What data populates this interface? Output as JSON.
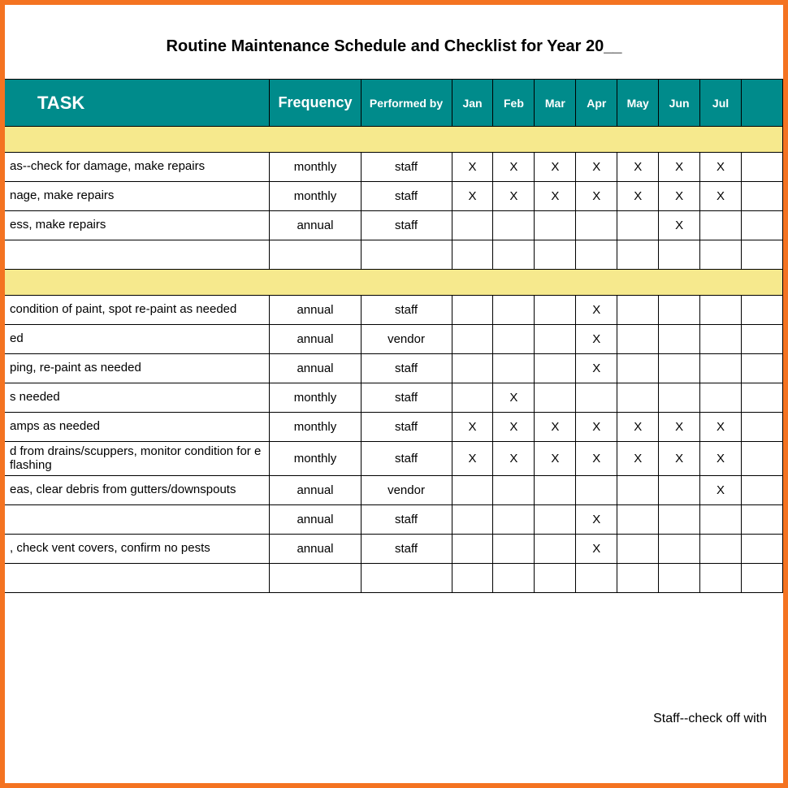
{
  "title": "Routine Maintenance Schedule and Checklist for Year 20__",
  "headers": {
    "task": "TASK",
    "frequency": "Frequency",
    "performed_by": "Performed by",
    "months": [
      "Jan",
      "Feb",
      "Mar",
      "Apr",
      "May",
      "Jun",
      "Jul",
      ""
    ]
  },
  "mark": "X",
  "section1_rows": [
    {
      "task": "as--check for damage, make repairs",
      "freq": "monthly",
      "perf": "staff",
      "marks": [
        true,
        true,
        true,
        true,
        true,
        true,
        true,
        false
      ]
    },
    {
      "task": "nage, make repairs",
      "freq": "monthly",
      "perf": "staff",
      "marks": [
        true,
        true,
        true,
        true,
        true,
        true,
        true,
        false
      ]
    },
    {
      "task": "ess, make repairs",
      "freq": "annual",
      "perf": "staff",
      "marks": [
        false,
        false,
        false,
        false,
        false,
        true,
        false,
        false
      ]
    },
    {
      "task": "",
      "freq": "",
      "perf": "",
      "marks": [
        false,
        false,
        false,
        false,
        false,
        false,
        false,
        false
      ]
    }
  ],
  "section2_rows": [
    {
      "task": "condition of paint, spot re-paint as needed",
      "freq": "annual",
      "perf": "staff",
      "marks": [
        false,
        false,
        false,
        true,
        false,
        false,
        false,
        false
      ]
    },
    {
      "task": "ed",
      "freq": "annual",
      "perf": "vendor",
      "marks": [
        false,
        false,
        false,
        true,
        false,
        false,
        false,
        false
      ]
    },
    {
      "task": "ping, re-paint as needed",
      "freq": "annual",
      "perf": "staff",
      "marks": [
        false,
        false,
        false,
        true,
        false,
        false,
        false,
        false
      ]
    },
    {
      "task": "s needed",
      "freq": "monthly",
      "perf": "staff",
      "marks": [
        false,
        true,
        false,
        false,
        false,
        false,
        false,
        false
      ]
    },
    {
      "task": "amps as needed",
      "freq": "monthly",
      "perf": "staff",
      "marks": [
        true,
        true,
        true,
        true,
        true,
        true,
        true,
        false
      ]
    },
    {
      "task": "d from drains/scuppers, monitor condition for e flashing",
      "freq": "monthly",
      "perf": "staff",
      "marks": [
        true,
        true,
        true,
        true,
        true,
        true,
        true,
        false
      ]
    },
    {
      "task": "eas, clear debris from gutters/downspouts",
      "freq": "annual",
      "perf": "vendor",
      "marks": [
        false,
        false,
        false,
        false,
        false,
        false,
        true,
        false
      ]
    },
    {
      "task": "",
      "freq": "annual",
      "perf": "staff",
      "marks": [
        false,
        false,
        false,
        true,
        false,
        false,
        false,
        false
      ]
    },
    {
      "task": ", check vent covers, confirm no pests",
      "freq": "annual",
      "perf": "staff",
      "marks": [
        false,
        false,
        false,
        true,
        false,
        false,
        false,
        false
      ]
    },
    {
      "task": "",
      "freq": "",
      "perf": "",
      "marks": [
        false,
        false,
        false,
        false,
        false,
        false,
        false,
        false
      ]
    }
  ],
  "footer_note": "Staff--check off with"
}
